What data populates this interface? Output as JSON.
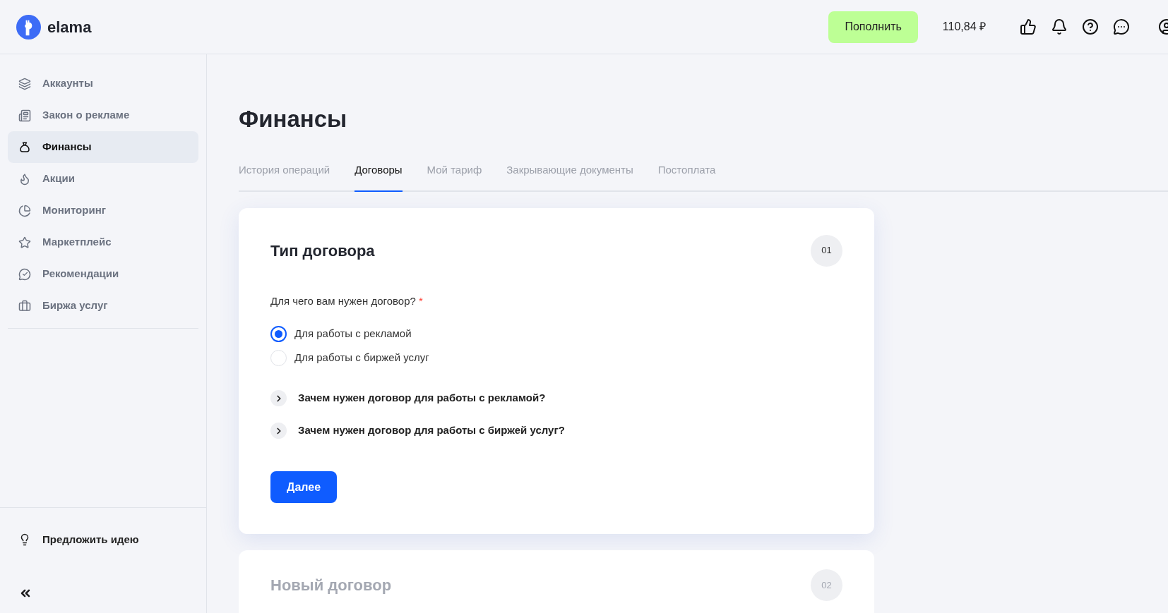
{
  "header": {
    "logo_text": "elama",
    "topup_button": "Пополнить",
    "balance": "110,84 ₽"
  },
  "sidebar": {
    "items": [
      {
        "label": "Аккаунты",
        "selected": false
      },
      {
        "label": "Закон о рекламе",
        "selected": false
      },
      {
        "label": "Финансы",
        "selected": true
      },
      {
        "label": "Акции",
        "selected": false
      },
      {
        "label": "Мониторинг",
        "selected": false
      },
      {
        "label": "Маркетплейс",
        "selected": false
      },
      {
        "label": "Рекомендации",
        "selected": false
      },
      {
        "label": "Биржа услуг",
        "selected": false
      }
    ],
    "suggest_idea": "Предложить идею"
  },
  "page": {
    "title": "Финансы",
    "tabs": [
      {
        "label": "История операций",
        "selected": false
      },
      {
        "label": "Договоры",
        "selected": true
      },
      {
        "label": "Мой тариф",
        "selected": false
      },
      {
        "label": "Закрывающие документы",
        "selected": false
      },
      {
        "label": "Постоплата",
        "selected": false
      }
    ]
  },
  "steps": [
    {
      "title": "Тип договора",
      "number": "01",
      "active": true,
      "question": "Для чего вам нужен договор?",
      "required_mark": "*",
      "options": [
        {
          "label": "Для работы с рекламой",
          "selected": true
        },
        {
          "label": "Для работы с биржей услуг",
          "selected": false
        }
      ],
      "faq": [
        {
          "label": "Зачем нужен договор для работы с рекламой?",
          "expanded": false
        },
        {
          "label": "Зачем нужен договор для работы с биржей услуг?",
          "expanded": false
        }
      ],
      "next_button": "Далее"
    },
    {
      "title": "Новый договор",
      "number": "02",
      "active": false
    }
  ]
}
